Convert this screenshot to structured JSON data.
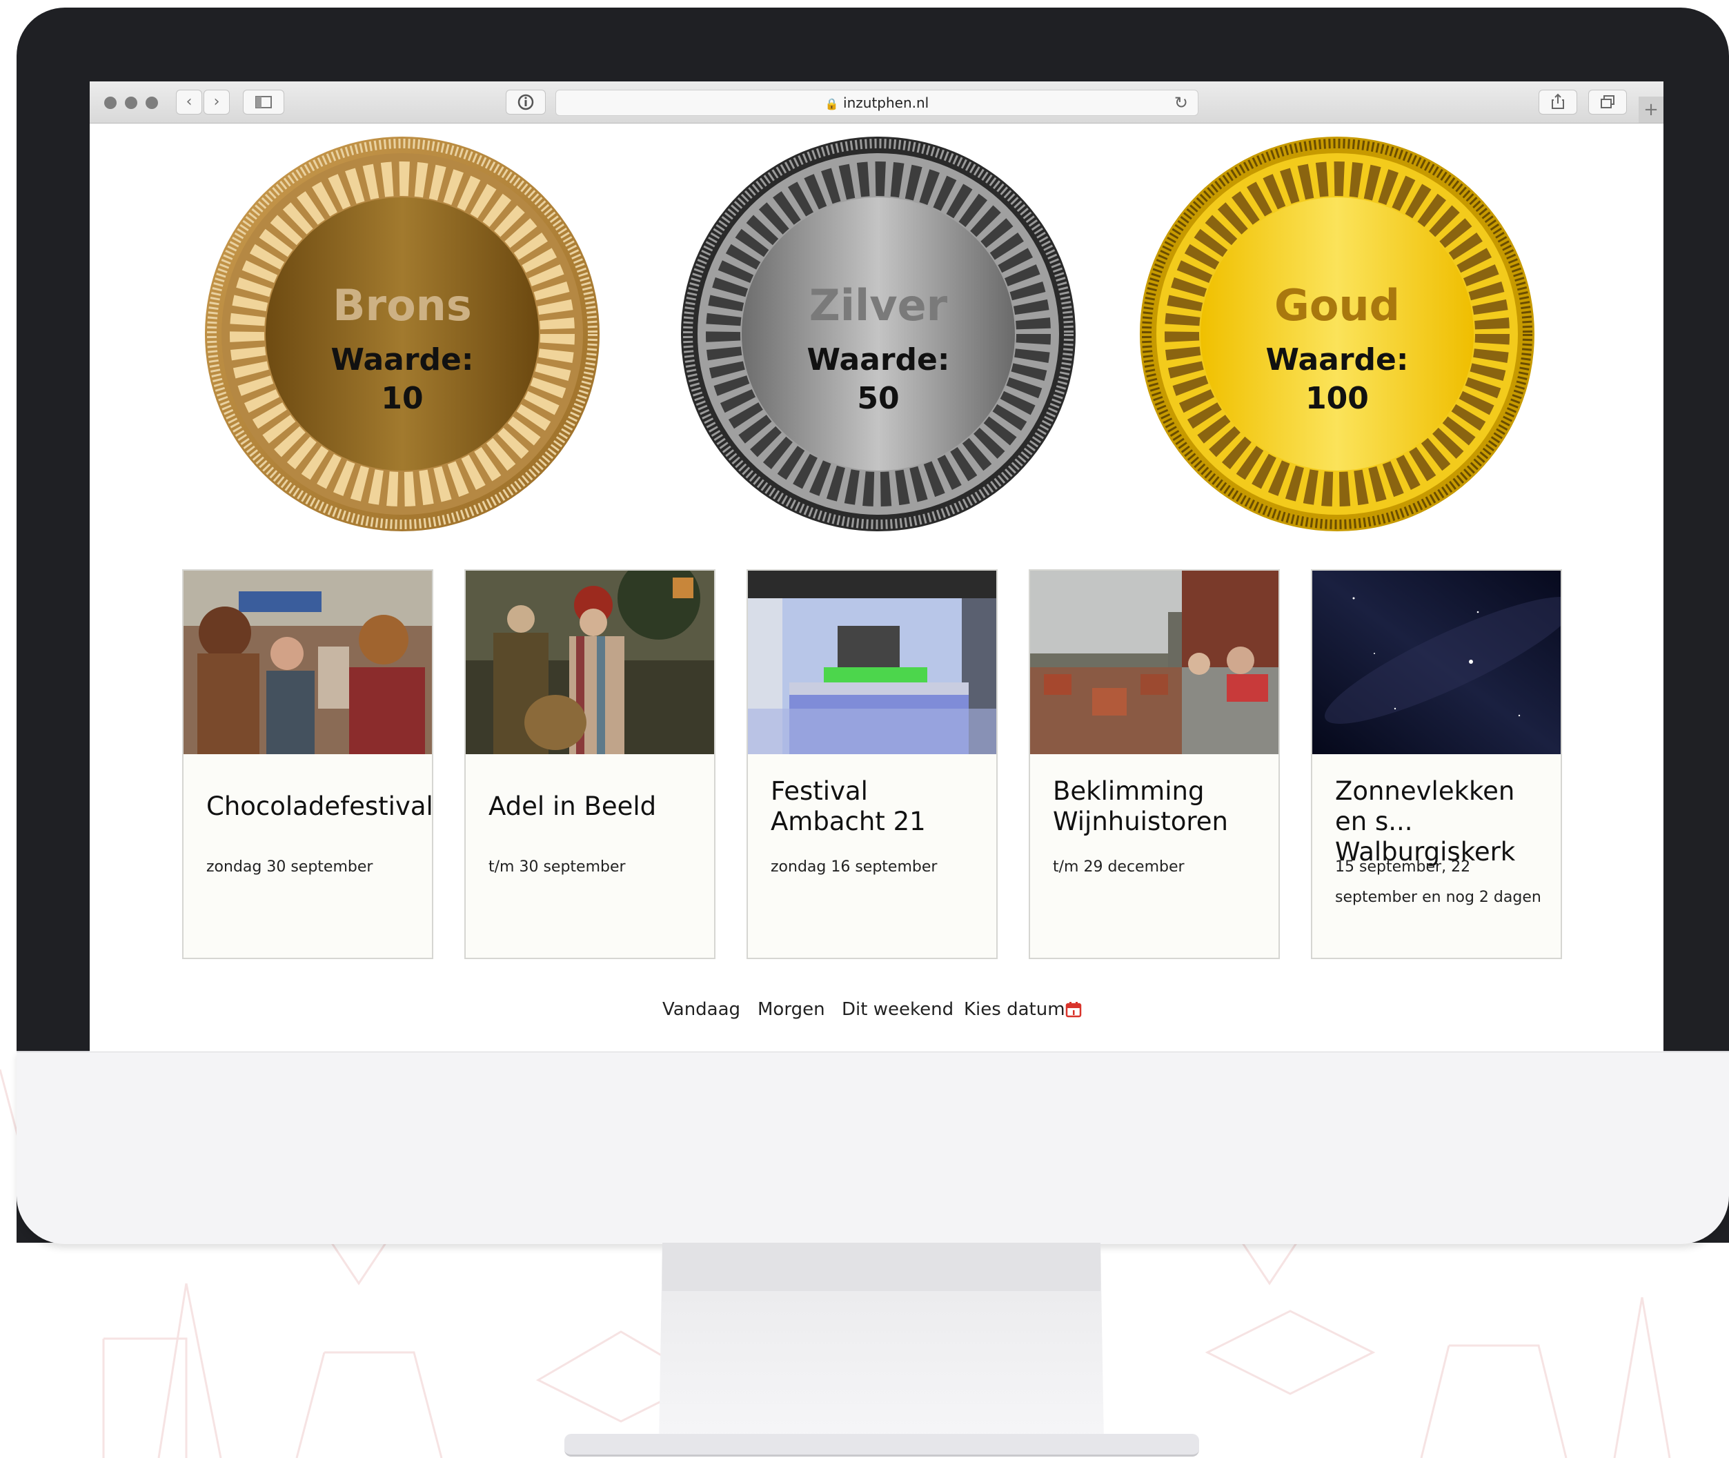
{
  "browser": {
    "url": "inzutphen.nl",
    "back_icon": "chevron-left-icon",
    "forward_icon": "chevron-right-icon",
    "sidebar_icon": "sidebar-icon",
    "info_icon": "info-icon",
    "lock_icon": "lock-icon",
    "reload_icon": "reload-icon",
    "share_icon": "share-icon",
    "tabs_icon": "tabs-icon",
    "new_tab_icon": "plus-icon"
  },
  "medals": [
    {
      "name": "Brons",
      "label": "Waarde:",
      "value": "10",
      "color": "#8b6420"
    },
    {
      "name": "Zilver",
      "label": "Waarde:",
      "value": "50",
      "color": "#8e8e8e"
    },
    {
      "name": "Goud",
      "label": "Waarde:",
      "value": "100",
      "color": "#f2c600"
    }
  ],
  "events": [
    {
      "title": "Chocoladefestival",
      "date": "zondag 30 september"
    },
    {
      "title": "Adel in Beeld",
      "date": "t/m 30 september"
    },
    {
      "title": "Festival Ambacht 21",
      "date": "zondag 16 september"
    },
    {
      "title": "Beklimming Wijnhuistoren",
      "date": "t/m 29 december"
    },
    {
      "title": "Zonnevlekken en s... Walburgiskerk",
      "date": "15 september, 22 september en nog 2 dagen"
    }
  ],
  "nav": {
    "today": "Vandaag",
    "tomorrow": "Morgen",
    "weekend": "Dit weekend",
    "pick_date": "Kies datum",
    "calendar_icon": "calendar-icon"
  }
}
